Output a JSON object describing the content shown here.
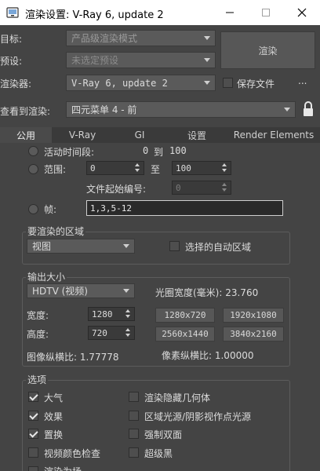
{
  "window": {
    "title": "渲染设置: V-Ray 6, update 2"
  },
  "top": {
    "target_label": "目标:",
    "target_value": "产品级渲染模式",
    "preset_label": "预设:",
    "preset_value": "未选定预设",
    "renderer_label": "渲染器:",
    "renderer_value": "V-Ray 6, update 2",
    "save_file_label": "保存文件",
    "more_label": "...",
    "view_label": "查看到渲染:",
    "view_value": "四元菜单 4 - 前",
    "render_button": "渲染"
  },
  "tabs": [
    {
      "label": "公用"
    },
    {
      "label": "V-Ray"
    },
    {
      "label": "GI"
    },
    {
      "label": "设置"
    },
    {
      "label": "Render Elements"
    }
  ],
  "time_output": {
    "active_time_label": "活动时间段:",
    "active_from": "0",
    "active_to_word": "到",
    "active_to": "100",
    "range_label": "范围:",
    "range_from": "0",
    "range_to_word": "至",
    "range_to": "100",
    "file_number_label": "文件起始编号:",
    "file_number_value": "0",
    "frames_label": "帧:",
    "frames_value": "1,3,5-12"
  },
  "area": {
    "group_label": "要渲染的区域",
    "area_value": "视图",
    "auto_region_label": "选择的自动区域"
  },
  "output_size": {
    "group_label": "输出大小",
    "preset_value": "HDTV (视频)",
    "aperture_label": "光圈宽度(毫米): 23.760",
    "width_label": "宽度:",
    "width_value": "1280",
    "height_label": "高度:",
    "height_value": "720",
    "size_buttons": [
      "1280x720",
      "1920x1080",
      "2560x1440",
      "3840x2160"
    ],
    "image_aspect_label": "图像纵横比: 1.77778",
    "pixel_aspect_label": "像素纵横比: 1.00000"
  },
  "options": {
    "group_label": "选项",
    "left": [
      {
        "label": "大气",
        "checked": true
      },
      {
        "label": "效果",
        "checked": true
      },
      {
        "label": "置换",
        "checked": true
      },
      {
        "label": "视频颜色检查",
        "checked": false
      },
      {
        "label": "渲染为场",
        "checked": false
      }
    ],
    "right": [
      {
        "label": "渲染隐藏几何体",
        "checked": false
      },
      {
        "label": "区域光源/阴影视作点光源",
        "checked": false
      },
      {
        "label": "强制双面",
        "checked": false
      },
      {
        "label": "超级黑",
        "checked": false
      }
    ]
  },
  "colors": {
    "background": "#444444",
    "titlebar": "#ffffff",
    "field": "#5a5a5a"
  }
}
